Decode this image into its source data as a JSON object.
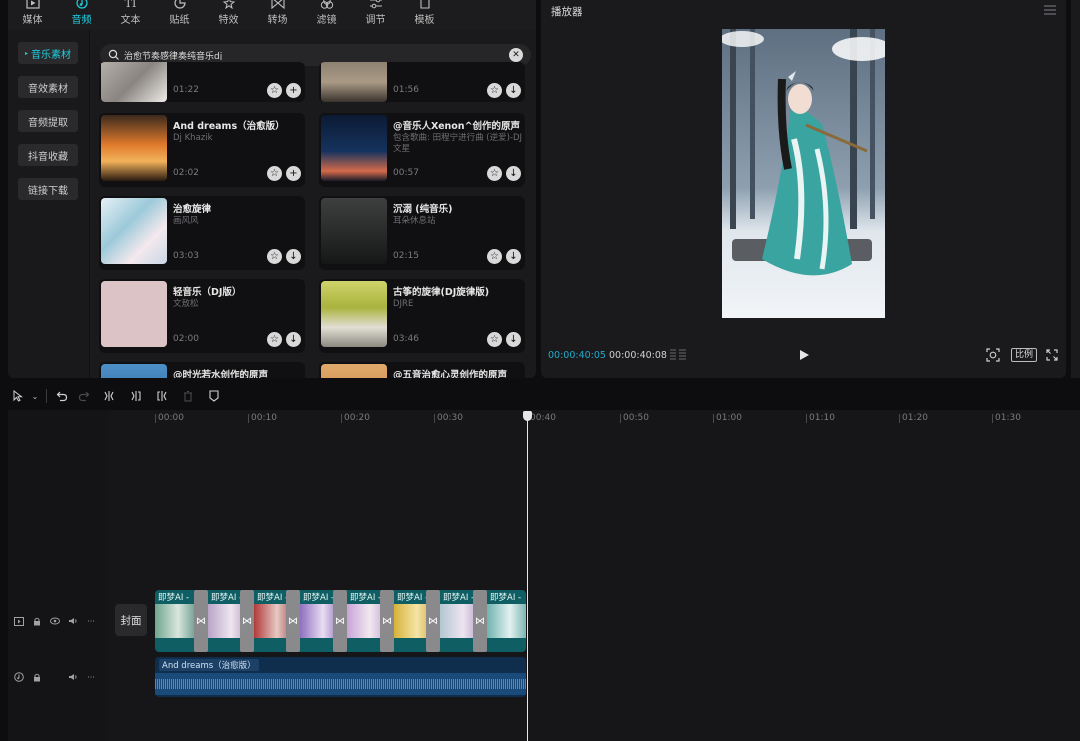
{
  "toolbar": {
    "tabs": [
      {
        "label": "媒体",
        "icon": "media-icon"
      },
      {
        "label": "音频",
        "icon": "audio-icon",
        "active": true
      },
      {
        "label": "文本",
        "icon": "text-icon"
      },
      {
        "label": "贴纸",
        "icon": "sticker-icon"
      },
      {
        "label": "特效",
        "icon": "effects-icon"
      },
      {
        "label": "转场",
        "icon": "transition-icon"
      },
      {
        "label": "滤镜",
        "icon": "filter-icon"
      },
      {
        "label": "调节",
        "icon": "adjust-icon"
      },
      {
        "label": "模板",
        "icon": "template-icon"
      }
    ]
  },
  "sidebar": {
    "items": [
      {
        "label": "音乐素材",
        "active": true
      },
      {
        "label": "音效素材"
      },
      {
        "label": "音频提取"
      },
      {
        "label": "抖音收藏"
      },
      {
        "label": "链接下载"
      }
    ]
  },
  "search": {
    "value": "治愈节奏感律奏纯音乐dj"
  },
  "cards": [
    {
      "title": "",
      "subtitle": "",
      "duration": "01:22",
      "action": "add"
    },
    {
      "title": "",
      "subtitle": "",
      "duration": "01:56",
      "action": "download"
    },
    {
      "title": "And dreams（治愈版）",
      "subtitle": "Dj Khazik",
      "duration": "02:02",
      "action": "add"
    },
    {
      "title": "@音乐人Xenon^创作的原声",
      "subtitle": "包含歌曲: 田程宁进行曲 (逆爱)-DJ文星",
      "duration": "00:57",
      "action": "download"
    },
    {
      "title": "治愈旋律",
      "subtitle": "画风风",
      "duration": "03:03",
      "action": "download"
    },
    {
      "title": "沉溺 (纯音乐)",
      "subtitle": "耳朵休息站",
      "duration": "02:15",
      "action": "download"
    },
    {
      "title": "轻音乐（DJ版）",
      "subtitle": "文敖松",
      "duration": "02:00",
      "action": "download"
    },
    {
      "title": "古筝的旋律(DJ旋律版)",
      "subtitle": "DJRE",
      "duration": "03:46",
      "action": "download"
    },
    {
      "title": "@时光若水创作的原声",
      "subtitle": "",
      "duration": "",
      "action": ""
    },
    {
      "title": "@五音治愈心灵创作的原声",
      "subtitle": "",
      "duration": "",
      "action": ""
    }
  ],
  "player": {
    "title": "播放器",
    "current_time": "00:00:40:05",
    "total_time": "00:00:40:08",
    "ratio_label": "比例"
  },
  "timeline": {
    "ruler": [
      "00:00",
      "00:10",
      "00:20",
      "00:30",
      "00:40",
      "00:50",
      "01:00",
      "01:10",
      "01:20",
      "01:30"
    ],
    "cover_label": "封面",
    "video_clip_label": "即梦AI -",
    "audio_clip_label": "And dreams（治愈版）"
  },
  "colors": {
    "accent": "#21d0e0",
    "video_track": "#0f5e63",
    "audio_track": "#0f2d4d"
  }
}
